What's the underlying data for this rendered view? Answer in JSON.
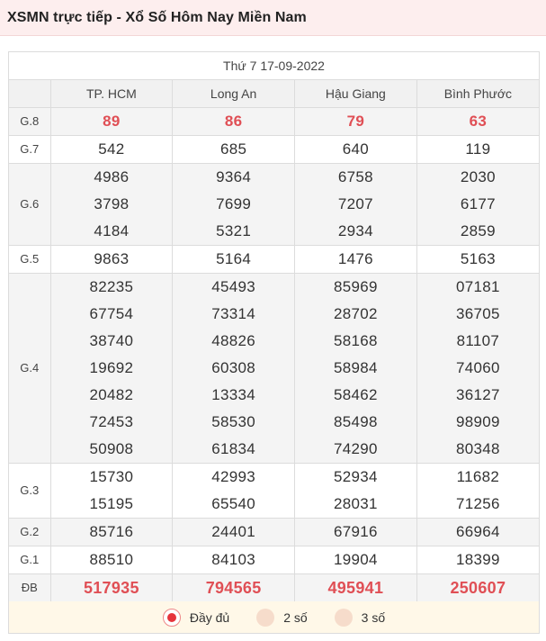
{
  "header": {
    "title": "XSMN trực tiếp - Xổ Số Hôm Nay Miền Nam"
  },
  "date": "Thứ 7 17-09-2022",
  "provinces": [
    "TP. HCM",
    "Long An",
    "Hậu Giang",
    "Bình Phước"
  ],
  "prizes": [
    {
      "label": "G.8",
      "style": "red",
      "values": [
        [
          "89"
        ],
        [
          "86"
        ],
        [
          "79"
        ],
        [
          "63"
        ]
      ]
    },
    {
      "label": "G.7",
      "style": "normal",
      "values": [
        [
          "542"
        ],
        [
          "685"
        ],
        [
          "640"
        ],
        [
          "119"
        ]
      ]
    },
    {
      "label": "G.6",
      "style": "normal",
      "values": [
        [
          "4986",
          "3798",
          "4184"
        ],
        [
          "9364",
          "7699",
          "5321"
        ],
        [
          "6758",
          "7207",
          "2934"
        ],
        [
          "2030",
          "6177",
          "2859"
        ]
      ]
    },
    {
      "label": "G.5",
      "style": "normal",
      "values": [
        [
          "9863"
        ],
        [
          "5164"
        ],
        [
          "1476"
        ],
        [
          "5163"
        ]
      ]
    },
    {
      "label": "G.4",
      "style": "normal",
      "values": [
        [
          "82235",
          "67754",
          "38740",
          "19692",
          "20482",
          "72453",
          "50908"
        ],
        [
          "45493",
          "73314",
          "48826",
          "60308",
          "13334",
          "58530",
          "61834"
        ],
        [
          "85969",
          "28702",
          "58168",
          "58984",
          "58462",
          "85498",
          "74290"
        ],
        [
          "07181",
          "36705",
          "81107",
          "74060",
          "36127",
          "98909",
          "80348"
        ]
      ]
    },
    {
      "label": "G.3",
      "style": "normal",
      "values": [
        [
          "15730",
          "15195"
        ],
        [
          "42993",
          "65540"
        ],
        [
          "52934",
          "28031"
        ],
        [
          "11682",
          "71256"
        ]
      ]
    },
    {
      "label": "G.2",
      "style": "normal",
      "values": [
        [
          "85716"
        ],
        [
          "24401"
        ],
        [
          "67916"
        ],
        [
          "66964"
        ]
      ]
    },
    {
      "label": "G.1",
      "style": "normal",
      "values": [
        [
          "88510"
        ],
        [
          "84103"
        ],
        [
          "19904"
        ],
        [
          "18399"
        ]
      ]
    },
    {
      "label": "ĐB",
      "style": "db",
      "values": [
        [
          "517935"
        ],
        [
          "794565"
        ],
        [
          "495941"
        ],
        [
          "250607"
        ]
      ]
    }
  ],
  "options": [
    {
      "label": "Đầy đủ",
      "selected": true
    },
    {
      "label": "2 số",
      "selected": false
    },
    {
      "label": "3 số",
      "selected": false
    }
  ]
}
